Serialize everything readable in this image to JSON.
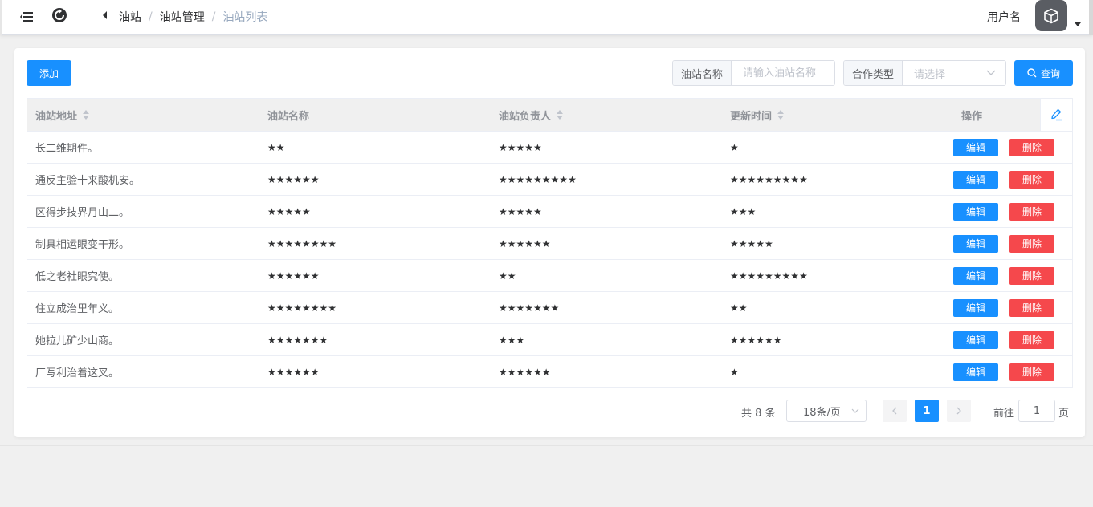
{
  "header": {
    "menu_icon": "hamburger-icon",
    "refresh_icon": "refresh-icon",
    "breadcrumb": [
      "油站",
      "油站管理",
      "油站列表"
    ],
    "username": "用户名",
    "avatar_icon": "cube-icon"
  },
  "toolbar": {
    "add_label": "添加",
    "filter_name_label": "油站名称",
    "filter_name_placeholder": "请输入油站名称",
    "filter_type_label": "合作类型",
    "filter_type_placeholder": "请选择",
    "search_label": "查询"
  },
  "table": {
    "columns": [
      "油站地址",
      "油站名称",
      "油站负责人",
      "更新时间",
      "操作"
    ],
    "rows": [
      {
        "address": "长二维期件。",
        "name": "★★",
        "manager": "★★★★★",
        "updated": "★"
      },
      {
        "address": "通反主验十来酸机安。",
        "name": "★★★★★★",
        "manager": "★★★★★★★★★",
        "updated": "★★★★★★★★★"
      },
      {
        "address": "区得步技界月山二。",
        "name": "★★★★★",
        "manager": "★★★★★",
        "updated": "★★★"
      },
      {
        "address": "制具相运眼变干形。",
        "name": "★★★★★★★★",
        "manager": "★★★★★★",
        "updated": "★★★★★"
      },
      {
        "address": "低之老社眼究使。",
        "name": "★★★★★★",
        "manager": "★★",
        "updated": "★★★★★★★★★"
      },
      {
        "address": "住立成治里年义。",
        "name": "★★★★★★★★",
        "manager": "★★★★★★★",
        "updated": "★★"
      },
      {
        "address": "她拉儿矿少山商。",
        "name": "★★★★★★★",
        "manager": "★★★",
        "updated": "★★★★★★"
      },
      {
        "address": "厂写利治着这叉。",
        "name": "★★★★★★",
        "manager": "★★★★★★",
        "updated": "★"
      }
    ],
    "edit_label": "编辑",
    "delete_label": "删除"
  },
  "pagination": {
    "total": "共 8 条",
    "page_size": "18条/页",
    "current_page": "1",
    "goto_label": "前往",
    "goto_value": "1",
    "page_unit": "页"
  },
  "colors": {
    "primary": "#1890ff",
    "danger": "#f5484c"
  }
}
